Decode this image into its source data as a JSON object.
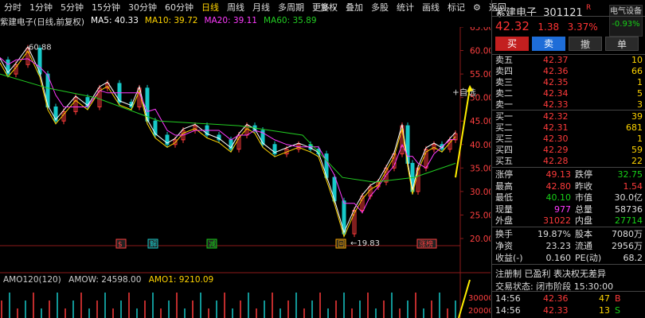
{
  "toolbar": {
    "items": [
      "分时",
      "1分钟",
      "5分钟",
      "15分钟",
      "30分钟",
      "60分钟",
      "日线",
      "周线",
      "月线",
      "多周期",
      "更多 ›"
    ],
    "active_index": 6,
    "right_items": [
      "复权",
      "叠加",
      "多股",
      "统计",
      "画线",
      "标记"
    ],
    "settings_icon": "gear-icon",
    "back_label": "返回"
  },
  "ma": {
    "title": "紫建电子(日线,前复权)",
    "ma5": "MA5: 40.33",
    "ma10": "MA10: 39.72",
    "ma20": "MA20: 39.11",
    "ma60": "MA60: 35.89",
    "colors": {
      "ma5": "#ffffff",
      "ma10": "#ffd400",
      "ma20": "#ff3bff",
      "ma60": "#22cc22"
    }
  },
  "chart": {
    "y_ticks": [
      "65.00",
      "60.00",
      "55.00",
      "50.00",
      "45.00",
      "40.00",
      "35.00",
      "30.00",
      "25.00",
      "20.00"
    ],
    "y_values": [
      65,
      60,
      55,
      50,
      45,
      40,
      35,
      30,
      25,
      20
    ],
    "high_label": "60.88",
    "low_label": "19.83",
    "self_select": "+自选",
    "bottom_marks": [
      "$",
      "解",
      "减",
      "回",
      "涨榜"
    ]
  },
  "amo": {
    "label": "AMO120(120)",
    "amow": "AMOW: 24598.00",
    "amo1": "AMO1: 9210.09",
    "y_tick": "30000",
    "y_tick2": "20000"
  },
  "quote": {
    "name": "紫建电子",
    "code": "301121",
    "r_badge": "R",
    "price": "42.32",
    "change": "1.38",
    "pct": "3.37%",
    "sector_name": "电气设备",
    "sector_pct": "-0.93%",
    "buttons": [
      "买",
      "卖",
      "撤",
      "单"
    ]
  },
  "orderbook": {
    "asks": [
      {
        "label": "卖五",
        "price": "42.37",
        "vol": "10"
      },
      {
        "label": "卖四",
        "price": "42.36",
        "vol": "66"
      },
      {
        "label": "卖三",
        "price": "42.35",
        "vol": "1"
      },
      {
        "label": "卖二",
        "price": "42.34",
        "vol": "5"
      },
      {
        "label": "卖一",
        "price": "42.33",
        "vol": "3"
      }
    ],
    "bids": [
      {
        "label": "买一",
        "price": "42.32",
        "vol": "39"
      },
      {
        "label": "买二",
        "price": "42.31",
        "vol": "681"
      },
      {
        "label": "买三",
        "price": "42.30",
        "vol": "1"
      },
      {
        "label": "买四",
        "price": "42.29",
        "vol": "59"
      },
      {
        "label": "买五",
        "price": "42.28",
        "vol": "22"
      }
    ]
  },
  "stats": [
    {
      "l1": "涨停",
      "v1": "49.13",
      "c1": "red",
      "l2": "跌停",
      "v2": "32.75",
      "c2": "green"
    },
    {
      "l1": "最高",
      "v1": "42.80",
      "c1": "red",
      "l2": "昨收",
      "v2": "1.54",
      "c2": "red"
    },
    {
      "l1": "最低",
      "v1": "40.10",
      "c1": "green",
      "l2": "市值",
      "v2": "30.0亿",
      "c2": "white"
    },
    {
      "l1": "现量",
      "v1": "977",
      "c1": "magenta",
      "l2": "总量",
      "v2": "58736",
      "c2": "white"
    },
    {
      "l1": "外盘",
      "v1": "31022",
      "c1": "red",
      "l2": "内盘",
      "v2": "27714",
      "c2": "green"
    }
  ],
  "stats2": [
    {
      "l1": "换手",
      "v1": "19.87%",
      "c1": "white",
      "l2": "股本",
      "v2": "7080万",
      "c2": "white"
    },
    {
      "l1": "净资",
      "v1": "23.23",
      "c1": "white",
      "l2": "流通",
      "v2": "2956万",
      "c2": "white"
    },
    {
      "l1": "收益(-)",
      "v1": "0.160",
      "c1": "white",
      "l2": "PE(动)",
      "v2": "68.2",
      "c2": "white"
    }
  ],
  "notice": "注册制 已盈利 表决权无差异",
  "trade_status": "交易状态: 闭市阶段 15:30:00",
  "ticks": [
    {
      "time": "14:56",
      "price": "42.36",
      "vol": "47",
      "side": "B"
    },
    {
      "time": "14:56",
      "price": "42.33",
      "vol": "13",
      "side": "S"
    }
  ]
}
